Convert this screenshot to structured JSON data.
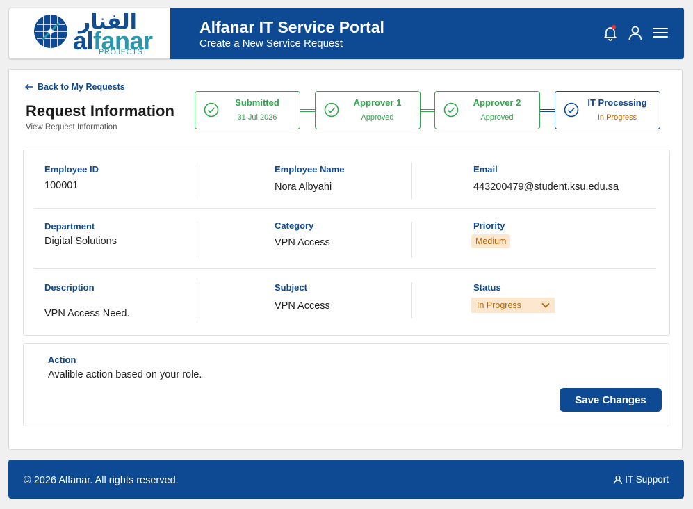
{
  "brand": {
    "arabic_name": "الفنار",
    "name_part1": "al",
    "name_part2": "fanar",
    "sub": "PROJECTS",
    "primary_color": "#0d4a93",
    "accent_color": "#2a97ad"
  },
  "header": {
    "title": "Alfanar IT Service Portal",
    "subtitle": "Create a New Service Request",
    "icons": [
      "bell-icon",
      "user-icon",
      "menu-icon"
    ]
  },
  "page": {
    "back_label": "Back to My Requests",
    "title": "Request Information",
    "subtitle": "View Request Information"
  },
  "stepper": [
    {
      "label": "Submitted",
      "sub": "31 Jul 2026",
      "state": "done"
    },
    {
      "label": "Approver 1",
      "sub": "Approved",
      "state": "done"
    },
    {
      "label": "Approver 2",
      "sub": "Approved",
      "state": "done"
    },
    {
      "label": "IT Processing",
      "sub": "In Progress",
      "state": "current"
    }
  ],
  "fields": {
    "employee_id": {
      "label": "Employee ID",
      "value": "100001"
    },
    "employee_name": {
      "label": "Employee Name",
      "value": "Nora Albyahi"
    },
    "email": {
      "label": "Email",
      "value": "443200479@student.ksu.edu.sa"
    },
    "department": {
      "label": "Department",
      "value": "Digital Solutions"
    },
    "category": {
      "label": "Category",
      "value": "VPN Access"
    },
    "priority": {
      "label": "Priority",
      "value": "Medium"
    },
    "description": {
      "label": "Description",
      "value": "VPN Access Need."
    },
    "subject": {
      "label": "Subject",
      "value": "VPN Access"
    },
    "status": {
      "label": "Status",
      "value": "In Progress"
    }
  },
  "action": {
    "title": "Action",
    "description": "Avalible action based on your role.",
    "save_label": "Save Changes"
  },
  "footer": {
    "copyright": "© 2026 Alfanar. All rights reserved.",
    "support_label": "IT Support"
  }
}
